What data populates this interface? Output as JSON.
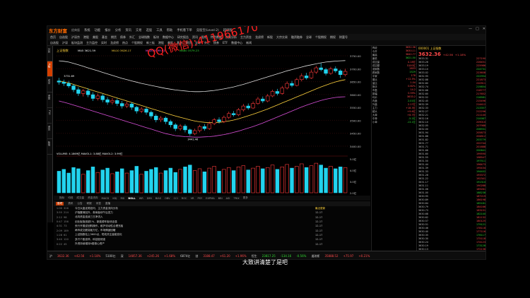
{
  "app": {
    "logo": "东方财富",
    "logo_sub": "经典版",
    "menus": [
      "系统",
      "功能",
      "报价",
      "分析",
      "资讯",
      "交易",
      "选股",
      "工具",
      "帮助",
      "手机看下单",
      "竞股宝(Level-2)",
      "超级版"
    ],
    "controls": [
      "—",
      "□",
      "✕"
    ]
  },
  "watermark": {
    "line1": "QQ(微信):411966170",
    "line2": ""
  },
  "navbar": [
    "首页",
    "自选股",
    "沪深京",
    "港股",
    "美股",
    "基金",
    "期货",
    "债券",
    "外汇",
    "全球指数",
    "板块",
    "数据中心",
    "研究报告",
    "资讯",
    "股吧",
    "特色数据",
    "决策分析",
    "主力资金",
    "龙虎榜",
    "新股",
    "大宗交易",
    "融资融券",
    "全球",
    "个股期权",
    "期权",
    "财富号"
  ],
  "toolbar2": [
    "自选股",
    "沪深",
    "板块监测",
    "主力监控",
    "实时",
    "龙虎榜",
    "热点",
    "个股期权",
    "新三板",
    "港股",
    "美股",
    "基金",
    "期货",
    "全球",
    "外汇",
    "债券",
    "ETF",
    "数据中心",
    "新闻"
  ],
  "left_tabs": [
    "分时",
    "K线",
    "成交",
    "资金",
    "F10",
    "资讯",
    "板块"
  ],
  "chart_header": {
    "symbol_label": "上证指数",
    "ma_labels": [
      {
        "text": "MA5 3621.59",
        "color": "#ffffff"
      },
      {
        "text": "MA10 3626.17",
        "color": "#ffd23d"
      },
      {
        "text": "MA20 3599.01",
        "color": "#ff55ff"
      },
      {
        "text": "MA60 3579.23",
        "color": "#33dd33"
      }
    ],
    "high_label": "3731.69",
    "low_label": "3441.46",
    "y_labels": [
      "3750.00",
      "3700.00",
      "3650.00",
      "3600.00",
      "3550.00",
      "3500.00",
      "3450.00",
      "3400.00"
    ],
    "vol_label": "VOLUME: 4.1869亿  MAVOL1: 3.88亿  MAVOL2: 3.99亿",
    "vol_y_labels": [
      "5.0亿",
      "4.0亿",
      "3.0亿",
      "2.0亿"
    ]
  },
  "chart_data": {
    "type": "candlestick",
    "candles": [
      [
        3660,
        3655,
        3672,
        3645
      ],
      [
        3655,
        3650,
        3665,
        3640
      ],
      [
        3650,
        3640,
        3660,
        3632
      ],
      [
        3640,
        3625,
        3648,
        3615
      ],
      [
        3625,
        3610,
        3635,
        3600
      ],
      [
        3610,
        3620,
        3628,
        3598
      ],
      [
        3620,
        3605,
        3630,
        3595
      ],
      [
        3605,
        3590,
        3615,
        3580
      ],
      [
        3590,
        3600,
        3610,
        3582
      ],
      [
        3600,
        3585,
        3608,
        3575
      ],
      [
        3585,
        3575,
        3595,
        3565
      ],
      [
        3575,
        3582,
        3592,
        3566
      ],
      [
        3582,
        3570,
        3590,
        3560
      ],
      [
        3570,
        3560,
        3580,
        3550
      ],
      [
        3560,
        3568,
        3578,
        3552
      ],
      [
        3568,
        3555,
        3575,
        3545
      ],
      [
        3555,
        3540,
        3560,
        3530
      ],
      [
        3540,
        3548,
        3556,
        3532
      ],
      [
        3548,
        3535,
        3555,
        3525
      ],
      [
        3535,
        3520,
        3542,
        3510
      ],
      [
        3520,
        3505,
        3528,
        3495
      ],
      [
        3505,
        3512,
        3520,
        3496
      ],
      [
        3512,
        3498,
        3518,
        3488
      ],
      [
        3498,
        3485,
        3505,
        3475
      ],
      [
        3485,
        3470,
        3492,
        3460
      ],
      [
        3470,
        3480,
        3488,
        3462
      ],
      [
        3480,
        3465,
        3488,
        3455
      ],
      [
        3465,
        3450,
        3470,
        3441
      ],
      [
        3450,
        3462,
        3470,
        3444
      ],
      [
        3462,
        3478,
        3485,
        3455
      ],
      [
        3478,
        3470,
        3488,
        3462
      ],
      [
        3470,
        3490,
        3498,
        3465
      ],
      [
        3490,
        3505,
        3512,
        3484
      ],
      [
        3505,
        3498,
        3515,
        3490
      ],
      [
        3498,
        3515,
        3522,
        3492
      ],
      [
        3515,
        3530,
        3538,
        3508
      ],
      [
        3530,
        3525,
        3540,
        3518
      ],
      [
        3525,
        3545,
        3552,
        3520
      ],
      [
        3545,
        3560,
        3568,
        3538
      ],
      [
        3560,
        3552,
        3570,
        3545
      ],
      [
        3552,
        3570,
        3578,
        3548
      ],
      [
        3570,
        3588,
        3596,
        3565
      ],
      [
        3588,
        3580,
        3598,
        3572
      ],
      [
        3580,
        3600,
        3608,
        3575
      ],
      [
        3600,
        3618,
        3625,
        3595
      ],
      [
        3618,
        3610,
        3628,
        3602
      ],
      [
        3610,
        3632,
        3640,
        3605
      ],
      [
        3632,
        3650,
        3658,
        3626
      ],
      [
        3650,
        3642,
        3660,
        3635
      ],
      [
        3642,
        3665,
        3672,
        3638
      ],
      [
        3665,
        3680,
        3690,
        3658
      ],
      [
        3680,
        3672,
        3692,
        3665
      ],
      [
        3672,
        3695,
        3705,
        3668
      ],
      [
        3695,
        3712,
        3720,
        3688
      ],
      [
        3712,
        3705,
        3731,
        3698
      ],
      [
        3705,
        3690,
        3712,
        3682
      ],
      [
        3690,
        3708,
        3716,
        3684
      ],
      [
        3708,
        3700,
        3718,
        3692
      ],
      [
        3700,
        3685,
        3706,
        3672
      ],
      [
        3685,
        3698,
        3708,
        3678
      ]
    ],
    "upper_band": [
      3740,
      3738,
      3735,
      3730,
      3724,
      3718,
      3712,
      3706,
      3700,
      3694,
      3688,
      3682,
      3676,
      3670,
      3665,
      3660,
      3655,
      3650,
      3646,
      3642,
      3638,
      3634,
      3630,
      3627,
      3624,
      3622,
      3620,
      3618,
      3617,
      3617,
      3618,
      3620,
      3622,
      3625,
      3628,
      3632,
      3636,
      3641,
      3646,
      3652,
      3658,
      3664,
      3670,
      3676,
      3682,
      3688,
      3694,
      3700,
      3705,
      3710,
      3715,
      3720,
      3724,
      3728,
      3732,
      3735,
      3737,
      3739,
      3740,
      3741
    ],
    "lower_band": [
      3580,
      3575,
      3570,
      3564,
      3558,
      3552,
      3546,
      3540,
      3534,
      3528,
      3522,
      3516,
      3510,
      3504,
      3498,
      3492,
      3486,
      3480,
      3474,
      3468,
      3462,
      3456,
      3450,
      3446,
      3442,
      3440,
      3438,
      3437,
      3436,
      3436,
      3437,
      3438,
      3440,
      3443,
      3446,
      3450,
      3455,
      3460,
      3466,
      3472,
      3478,
      3485,
      3492,
      3500,
      3508,
      3516,
      3524,
      3532,
      3540,
      3548,
      3556,
      3563,
      3570,
      3576,
      3582,
      3587,
      3591,
      3594,
      3596,
      3597
    ],
    "ma_line": [
      3660,
      3656,
      3652,
      3646,
      3640,
      3634,
      3628,
      3622,
      3616,
      3610,
      3604,
      3598,
      3592,
      3586,
      3580,
      3574,
      3568,
      3562,
      3556,
      3550,
      3544,
      3538,
      3532,
      3526,
      3520,
      3515,
      3510,
      3505,
      3500,
      3497,
      3495,
      3494,
      3494,
      3495,
      3497,
      3500,
      3504,
      3509,
      3515,
      3521,
      3527,
      3534,
      3541,
      3548,
      3556,
      3564,
      3572,
      3580,
      3588,
      3596,
      3604,
      3612,
      3620,
      3628,
      3636,
      3643,
      3650,
      3656,
      3661,
      3665
    ],
    "volume": [
      3.5,
      3.8,
      3.2,
      4.1,
      3.9,
      3.0,
      3.6,
      4.2,
      3.3,
      3.7,
      4.0,
      3.1,
      3.4,
      3.9,
      3.2,
      3.6,
      4.3,
      3.0,
      3.5,
      3.8,
      4.1,
      3.2,
      3.6,
      4.0,
      3.3,
      3.8,
      4.2,
      4.5,
      3.6,
      3.9,
      3.4,
      4.0,
      4.3,
      3.5,
      3.8,
      4.1,
      3.6,
      4.2,
      4.4,
      3.7,
      4.0,
      4.3,
      3.9,
      4.1,
      4.5,
      3.8,
      4.2,
      4.6,
      4.0,
      4.3,
      4.7,
      4.1,
      4.4,
      4.8,
      4.5,
      4.0,
      4.3,
      3.9,
      4.2,
      4.1
    ],
    "ylim": [
      3400,
      3760
    ],
    "vol_ylim": [
      0,
      5.5
    ]
  },
  "indicator_tabs": [
    "指标",
    "均线",
    "成交量",
    "资金流向",
    "MACD",
    "KDJ",
    "RSI",
    "BOLL",
    "WR",
    "DMI",
    "BIAS",
    "OBV",
    "CCI",
    "ROC",
    "VR",
    "PSY",
    "EXPMA",
    "BBI",
    "ASI",
    "TRIX",
    "更多"
  ],
  "news": {
    "tabs": [
      "股吧",
      "资讯",
      "公告",
      "研报",
      "问答",
      "直播"
    ],
    "rows": [
      {
        "time": "1:00",
        "count": "326",
        "text": "今日大盘走势如何，主力资金流向分析"
      },
      {
        "time": "3:55",
        "count": "214",
        "text": "沪指震荡回升，券商板块午后发力"
      },
      {
        "time": "2:12",
        "count": "98",
        "text": "北向资金连续三日净流入"
      },
      {
        "time": "0:47",
        "count": "156",
        "text": "创业板指涨超1%，新能源车板块走强"
      },
      {
        "time": "4:31",
        "count": "73",
        "text": "央行开展逆回购操作，维护流动性合理充裕"
      },
      {
        "time": "2:09",
        "count": "189",
        "text": "两市成交额突破万亿，市场情绪回暖"
      },
      {
        "time": "1:28",
        "count": "61",
        "text": "上证指数站上3600点，短线关注量能变化"
      },
      {
        "time": "3:40",
        "count": "120",
        "text": "多只个股涨停，科技股领涨"
      },
      {
        "time": "0:22",
        "count": "45",
        "text": "外资持续增持A股核心资产"
      }
    ],
    "right_header": "最近更新",
    "right_rows": [
      "12-17",
      "12-17",
      "12-17",
      "12-17",
      "12-17",
      "12-17",
      "12-17",
      "12-17"
    ]
  },
  "side": {
    "rows": [
      {
        "k": "昨收",
        "v": "3632.36",
        "c": "v"
      },
      {
        "k": "今开",
        "v": "3630.11",
        "c": "v"
      },
      {
        "k": "最高",
        "v": "3642.77",
        "c": "v"
      },
      {
        "k": "最低",
        "v": "3621.50",
        "c": "g"
      },
      {
        "k": "成交量",
        "v": "4.18亿",
        "c": "v"
      },
      {
        "k": "成交额",
        "v": "5100亿",
        "c": "v"
      },
      {
        "k": "涨家数",
        "v": "2853",
        "c": "v"
      },
      {
        "k": "跌家数",
        "v": "1529",
        "c": "g"
      },
      {
        "k": "平家",
        "v": "178",
        "c": "v"
      },
      {
        "k": "委比",
        "v": "+12.5%",
        "c": "v"
      },
      {
        "k": "量比",
        "v": "1.04",
        "c": "v"
      },
      {
        "k": "换手",
        "v": "0.82%",
        "c": "v"
      },
      {
        "k": "市盈",
        "v": "14.2",
        "c": "v"
      },
      {
        "k": "振幅",
        "v": "0.59%",
        "c": "v"
      },
      {
        "k": "均价",
        "v": "3633.2",
        "c": "v"
      },
      {
        "k": "内盘",
        "v": "2.01亿",
        "c": "g"
      },
      {
        "k": "外盘",
        "v": "2.17亿",
        "c": "v"
      },
      {
        "k": "主力",
        "v": "+18.3亿",
        "c": "v"
      },
      {
        "k": "超大",
        "v": "+9.6亿",
        "c": "v"
      },
      {
        "k": "大单",
        "v": "+8.7亿",
        "c": "v"
      },
      {
        "k": "中单",
        "v": "-5.2亿",
        "c": "g"
      },
      {
        "k": "小单",
        "v": "-13.1亿",
        "c": "g"
      }
    ]
  },
  "quote": {
    "code_name": "000001 上证指数",
    "price": "3632.36",
    "change": "+42.56",
    "pct": "+1.18%",
    "rows": [
      {
        "k": "3633.31",
        "v": "227190",
        "c": "v"
      },
      {
        "k": "3633.26",
        "v": "226451",
        "c": "v"
      },
      {
        "k": "3633.19",
        "v": "225986",
        "c": "v"
      },
      {
        "k": "3633.10",
        "v": "224731",
        "c": "g"
      },
      {
        "k": "3633.02",
        "v": "223608",
        "c": "v"
      },
      {
        "k": "3632.95",
        "v": "222954",
        "c": "g"
      },
      {
        "k": "3632.88",
        "v": "221873",
        "c": "v"
      },
      {
        "k": "3632.80",
        "v": "220911",
        "c": "v"
      },
      {
        "k": "3632.74",
        "v": "219854",
        "c": "g"
      },
      {
        "k": "3632.66",
        "v": "218777",
        "c": "v"
      },
      {
        "k": "3632.60",
        "v": "217652",
        "c": "v"
      },
      {
        "k": "3632.52",
        "v": "216581",
        "c": "g"
      },
      {
        "k": "3632.45",
        "v": "215496",
        "c": "v"
      },
      {
        "k": "3632.39",
        "v": "214412",
        "c": "v"
      },
      {
        "k": "3632.33",
        "v": "213357",
        "c": "g"
      },
      {
        "k": "3632.27",
        "v": "212296",
        "c": "v"
      },
      {
        "k": "3632.21",
        "v": "211140",
        "c": "v"
      },
      {
        "k": "3632.16",
        "v": "210087",
        "c": "g"
      },
      {
        "k": "3632.10",
        "v": "209010",
        "c": "v"
      },
      {
        "k": "3632.05",
        "v": "207988",
        "c": "v"
      },
      {
        "k": "3632.00",
        "v": "206931",
        "c": "g"
      },
      {
        "k": "3631.94",
        "v": "205873",
        "c": "v"
      },
      {
        "k": "3631.88",
        "v": "204812",
        "c": "v"
      },
      {
        "k": "3631.82",
        "v": "203779",
        "c": "g"
      },
      {
        "k": "3631.77",
        "v": "202744",
        "c": "v"
      },
      {
        "k": "3631.71",
        "v": "201688",
        "c": "v"
      },
      {
        "k": "3631.66",
        "v": "200641",
        "c": "g"
      },
      {
        "k": "3631.60",
        "v": "199590",
        "c": "v"
      },
      {
        "k": "3631.55",
        "v": "198547",
        "c": "v"
      },
      {
        "k": "3631.50",
        "v": "197511",
        "c": "g"
      },
      {
        "k": "3631.44",
        "v": "196473",
        "c": "v"
      },
      {
        "k": "3631.39",
        "v": "195434",
        "c": "v"
      },
      {
        "k": "3631.33",
        "v": "194402",
        "c": "g"
      },
      {
        "k": "3631.28",
        "v": "193372",
        "c": "v"
      },
      {
        "k": "3631.22",
        "v": "192341",
        "c": "v"
      },
      {
        "k": "3631.17",
        "v": "191310",
        "c": "g"
      },
      {
        "k": "3631.11",
        "v": "190288",
        "c": "v"
      },
      {
        "k": "3631.06",
        "v": "189261",
        "c": "v"
      },
      {
        "k": "3631.00",
        "v": "188238",
        "c": "g"
      },
      {
        "k": "3630.95",
        "v": "187219",
        "c": "v"
      },
      {
        "k": "3630.89",
        "v": "186198",
        "c": "v"
      },
      {
        "k": "3630.84",
        "v": "185181",
        "c": "g"
      },
      {
        "k": "3630.79",
        "v": "184166",
        "c": "v"
      },
      {
        "k": "3630.73",
        "v": "183151",
        "c": "v"
      },
      {
        "k": "3630.68",
        "v": "182140",
        "c": "g"
      },
      {
        "k": "3630.62",
        "v": "181132",
        "c": "v"
      },
      {
        "k": "3630.57",
        "v": "180125",
        "c": "v"
      },
      {
        "k": "3630.51",
        "v": "179121",
        "c": "g"
      },
      {
        "k": "3630.46",
        "v": "178118",
        "c": "v"
      },
      {
        "k": "3630.40",
        "v": "177116",
        "c": "v"
      },
      {
        "k": "3630.35",
        "v": "176117",
        "c": "g"
      },
      {
        "k": "3630.30",
        "v": "175118",
        "c": "v"
      },
      {
        "k": "3630.24",
        "v": "174123",
        "c": "v"
      },
      {
        "k": "3630.19",
        "v": "173128",
        "c": "g"
      },
      {
        "k": "3630.13",
        "v": "172136",
        "c": "v"
      },
      {
        "k": "3630.08",
        "v": "171145",
        "c": "v"
      }
    ]
  },
  "statusbar": [
    {
      "t": "沪",
      "c": ""
    },
    {
      "t": "3632.36",
      "c": "r"
    },
    {
      "t": "+42.56",
      "c": "r"
    },
    {
      "t": "+1.18%",
      "c": "r"
    },
    {
      "t": "5100亿",
      "c": ""
    },
    {
      "t": "深",
      "c": ""
    },
    {
      "t": "14857.36",
      "c": "r"
    },
    {
      "t": "+245.26",
      "c": "r"
    },
    {
      "t": "+1.68%",
      "c": "r"
    },
    {
      "t": "6874亿",
      "c": ""
    },
    {
      "t": "创",
      "c": ""
    },
    {
      "t": "3188.47",
      "c": "r"
    },
    {
      "t": "+61.20",
      "c": "r"
    },
    {
      "t": "+1.96%",
      "c": "r"
    },
    {
      "t": "恒生",
      "c": ""
    },
    {
      "t": "23817.25",
      "c": "g"
    },
    {
      "t": "-134.16",
      "c": "g"
    },
    {
      "t": "-0.56%",
      "c": "g"
    },
    {
      "t": "道琼斯",
      "c": ""
    },
    {
      "t": "35888.52",
      "c": "r"
    },
    {
      "t": "+75.97",
      "c": "r"
    },
    {
      "t": "+0.21%",
      "c": "r"
    }
  ],
  "subtitle": "大致讲清楚了是吧"
}
